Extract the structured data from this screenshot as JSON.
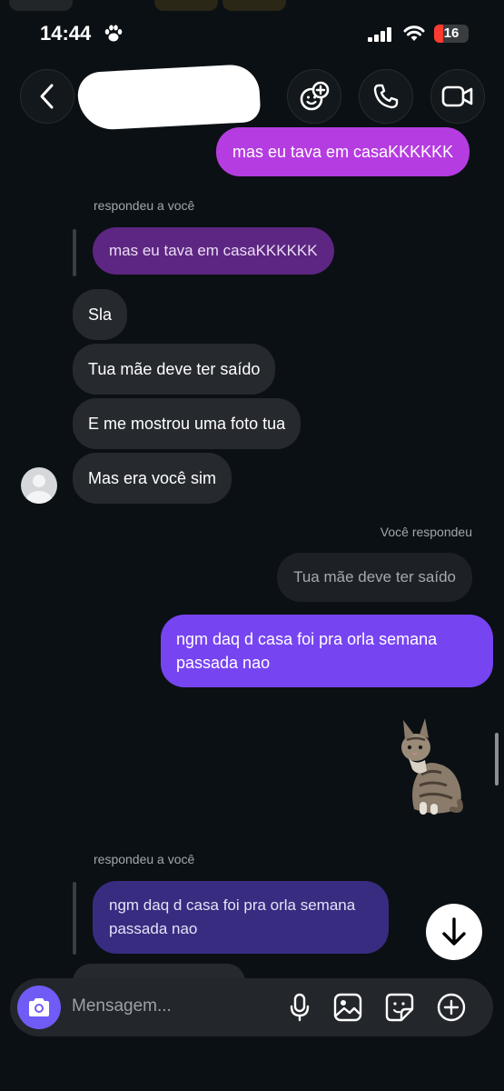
{
  "status_bar": {
    "time": "14:44",
    "battery": "16"
  },
  "header": {
    "back_icon": "chevron-left-icon",
    "actions": [
      {
        "name": "avatar-effects-button",
        "icon": "face-plus-icon"
      },
      {
        "name": "voice-call-button",
        "icon": "phone-icon"
      },
      {
        "name": "video-call-button",
        "icon": "video-icon"
      }
    ]
  },
  "messages": {
    "out1": "mas eu tava em casaKKKKKK",
    "reply_label_1": "respondeu a você",
    "quote1": "mas eu tava em casaKKKKKK",
    "in1": "Sla",
    "in2": "Tua mãe deve ter saído",
    "in3": "E me mostrou uma foto tua",
    "in4": "Mas era você sim",
    "reply_label_2": "Você respondeu",
    "quote2": "Tua mãe deve ter saído",
    "out2_line1": "ngm daq d casa foi pra orla semana",
    "out2_line2": "passada nao",
    "sticker": "cat-sticker",
    "reply_label_3": "respondeu a você",
    "quote3_line1": "ngm daq d casa foi pra orla semana",
    "quote3_line2": "passada nao"
  },
  "composer": {
    "placeholder": "Mensagem...",
    "icons": [
      "camera-icon",
      "microphone-icon",
      "image-icon",
      "sticker-icon",
      "plus-circle-icon"
    ]
  },
  "colors": {
    "background": "#0b1014",
    "incoming": "#262a2f",
    "outgoing_purple": "#b53ce0",
    "outgoing_violet": "#7744f2",
    "accent": "#6f5cf6"
  }
}
